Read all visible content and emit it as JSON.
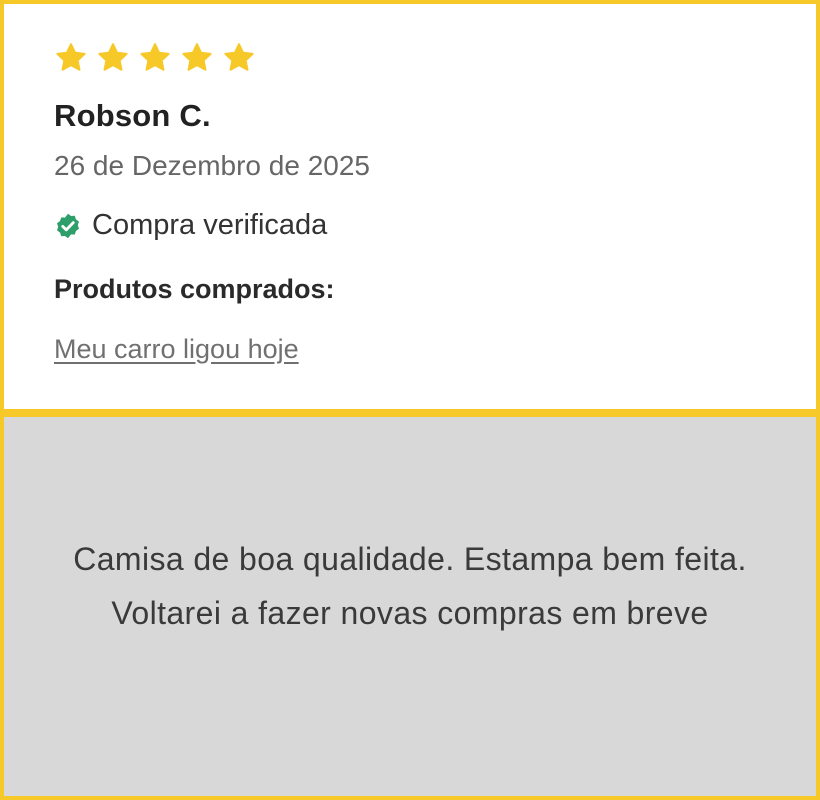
{
  "review": {
    "rating": 5,
    "reviewer_name": "Robson C.",
    "date": "26 de Dezembro de 2025",
    "verified_label": "Compra verificada",
    "products_label": "Produtos comprados:",
    "product_link": "Meu carro ligou hoje",
    "text": "Camisa de boa qualidade. Estampa bem feita. Voltarei a fazer novas compras em breve"
  },
  "colors": {
    "border": "#F6C928",
    "star": "#F6C928",
    "verified_check": "#2E9E6A",
    "body_background": "#D8D8D8"
  },
  "icons": {
    "star": "star-icon",
    "verified": "verified-check-icon"
  }
}
